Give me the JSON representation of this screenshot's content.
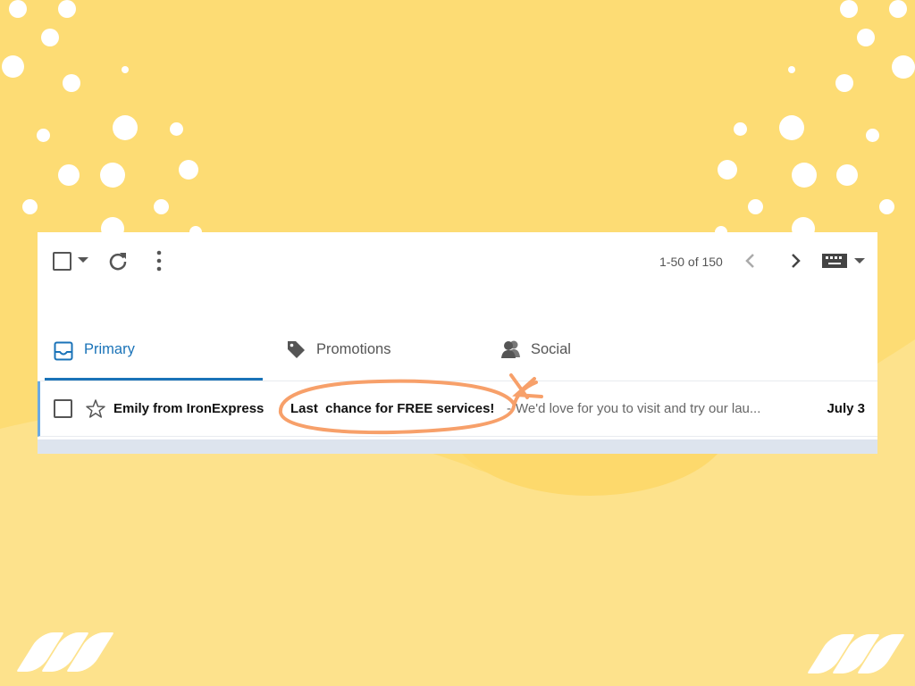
{
  "toolbar": {
    "select_all_icon": "checkbox-icon",
    "select_dropdown_icon": "caret-down-icon",
    "refresh_icon": "refresh-icon",
    "more_icon": "more-vert-icon",
    "pagination_text": "1-50 of 150",
    "prev_icon": "chevron-left-icon",
    "next_icon": "chevron-right-icon",
    "input_tools_icon": "keyboard-icon",
    "input_tools_dropdown_icon": "caret-down-icon"
  },
  "tabs": [
    {
      "label": "Primary",
      "icon": "inbox-icon",
      "active": true
    },
    {
      "label": "Promotions",
      "icon": "tag-icon",
      "active": false
    },
    {
      "label": "Social",
      "icon": "people-icon",
      "active": false
    }
  ],
  "emails": [
    {
      "sender": "Emily from IronExpress",
      "subject": "Last  chance for FREE services!",
      "separator": "-",
      "snippet": "We'd love for you to visit and try our lau...",
      "date": "July 3",
      "starred": false,
      "selected": false
    }
  ],
  "annotation": {
    "type": "circle-around-subject-with-x-mark",
    "color": "#f7a06a"
  },
  "colors": {
    "background": "#fddc74",
    "accent": "#1a73b8",
    "annotation": "#f7a06a"
  }
}
